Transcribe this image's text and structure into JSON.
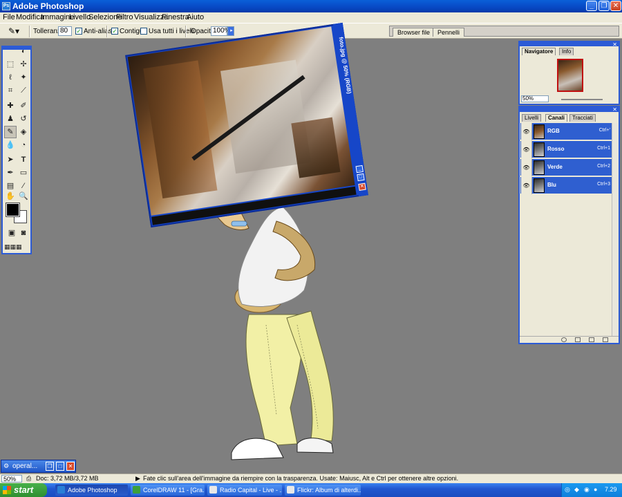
{
  "app": {
    "title": "Adobe Photoshop"
  },
  "menu": [
    "File",
    "Modifica",
    "Immagine",
    "Livello",
    "Selezione",
    "Filtro",
    "Visualizza",
    "Finestra",
    "Aiuto"
  ],
  "options": {
    "tolerance_label": "Tolleranza:",
    "tolerance_value": "80",
    "antialias_label": "Anti-alias",
    "antialias_checked": true,
    "contiguous_label": "Contiguo",
    "contiguous_checked": true,
    "all_layers_label": "Usa tutti i livelli",
    "all_layers_checked": false,
    "opacity_label": "Opacità:",
    "opacity_value": "100%"
  },
  "palette_well": {
    "tabs": [
      "Browser file",
      "Pennelli"
    ]
  },
  "document": {
    "title": "foto.jpg @ 50% (RGB)"
  },
  "navigator": {
    "tabs": [
      "Navigatore",
      "Info"
    ],
    "zoom": "50%"
  },
  "channels_panel": {
    "tabs": [
      "Livelli",
      "Canali",
      "Tracciati"
    ],
    "rows": [
      {
        "name": "RGB",
        "shortcut": "Ctrl+'"
      },
      {
        "name": "Rosso",
        "shortcut": "Ctrl+1"
      },
      {
        "name": "Verde",
        "shortcut": "Ctrl+2"
      },
      {
        "name": "Blu",
        "shortcut": "Ctrl+3"
      }
    ]
  },
  "minimized": {
    "label": "operal..."
  },
  "status": {
    "zoom": "50%",
    "doc": "Doc: 3,72 MB/3,72 MB",
    "message": "Fate clic sull'area dell'immagine da riempire con la trasparenza. Usate: Maiusc, Alt e Ctrl per ottenere altre opzioni."
  },
  "taskbar": {
    "start": "start",
    "tasks": [
      "Adobe Photoshop",
      "CorelDRAW 11 - [Gra...",
      "Radio Capital - Live - ...",
      "Flickr: Album di alterdi..."
    ],
    "clock": "7.29"
  },
  "colors": {
    "titlebar": "#0848c4",
    "panel_border": "#2c5bd6",
    "channel_row": "#2f5fd0",
    "background": "#7f7f7f"
  },
  "icons": [
    "magic-eraser-icon",
    "search-icon",
    "gear-icon"
  ]
}
